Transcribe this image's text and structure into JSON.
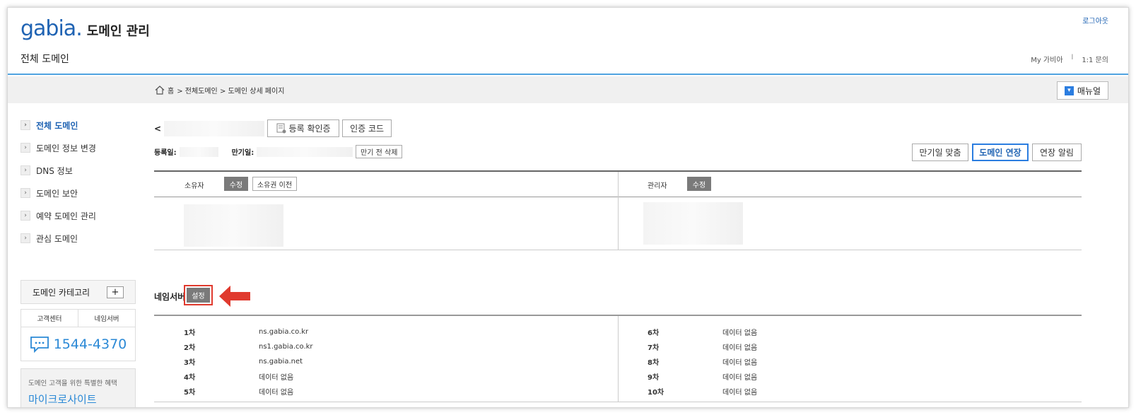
{
  "header": {
    "logo": "gabia",
    "logo_sub": "도메인 관리",
    "page_heading": "전체 도메인",
    "logout": "로그아웃",
    "my_gabia": "My 가비아",
    "sep": "l",
    "inquiry": "1:1 문의"
  },
  "breadcrumb": {
    "home": "홈",
    "path": "> 전체도메인 > 도메인 상세 페이지",
    "manual": "매뉴얼"
  },
  "sidebar": {
    "items": [
      {
        "label": "전체 도메인"
      },
      {
        "label": "도메인 정보 변경"
      },
      {
        "label": "DNS 정보"
      },
      {
        "label": "도메인 보안"
      },
      {
        "label": "예약 도메인 관리"
      },
      {
        "label": "관심 도메인"
      }
    ],
    "category": "도메인 카테고리",
    "cs_tabs": [
      "고객센터",
      "네임서버"
    ],
    "phone": "1544-4370",
    "promo_line1": "도메인 고객을 위한 특별한 혜택",
    "promo_line2": "마이크로사이트"
  },
  "domain": {
    "prefix": "<",
    "cert_button": "등록 확인증",
    "auth_button": "인증 코드",
    "reg_label": "등록일:",
    "exp_label": "만기일:",
    "pre_delete": "만기 전 삭제",
    "actions": [
      "만기일 맞춤",
      "도메인 연장",
      "연장 알림"
    ]
  },
  "contacts": {
    "owner_label": "소유자",
    "owner_edit": "수정",
    "owner_transfer": "소유권 이전",
    "admin_label": "관리자",
    "admin_edit": "수정"
  },
  "nameserver": {
    "title": "네임서버",
    "set_button": "설정",
    "left": [
      {
        "order": "1차",
        "value": "ns.gabia.co.kr"
      },
      {
        "order": "2차",
        "value": "ns1.gabia.co.kr"
      },
      {
        "order": "3차",
        "value": "ns.gabia.net"
      },
      {
        "order": "4차",
        "value": "데이터 없음"
      },
      {
        "order": "5차",
        "value": "데이터 없음"
      }
    ],
    "right": [
      {
        "order": "6차",
        "value": "데이터 없음"
      },
      {
        "order": "7차",
        "value": "데이터 없음"
      },
      {
        "order": "8차",
        "value": "데이터 없음"
      },
      {
        "order": "9차",
        "value": "데이터 없음"
      },
      {
        "order": "10차",
        "value": "데이터 없음"
      }
    ]
  },
  "colors": {
    "accent": "#1f63b3",
    "highlight": "#e03a2e"
  }
}
